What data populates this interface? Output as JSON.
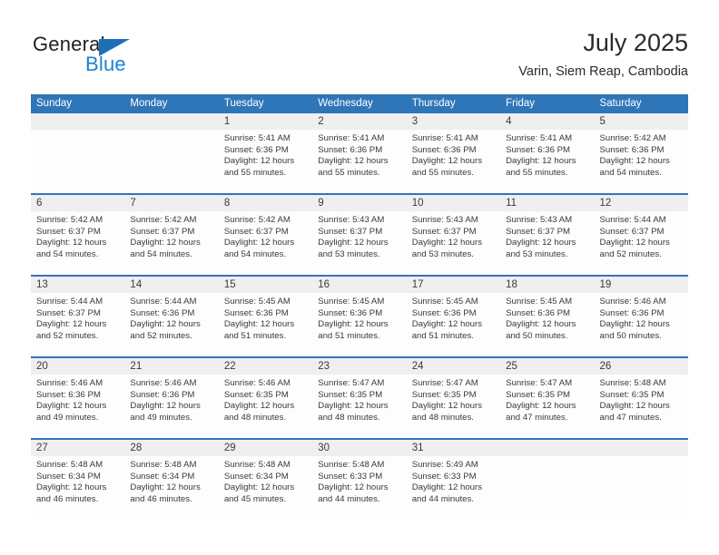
{
  "brand": {
    "name_part1": "General",
    "name_part2": "Blue",
    "triangle_icon": "triangle-icon",
    "color_dark": "#222222",
    "color_blue": "#1d82d2"
  },
  "header": {
    "title": "July 2025",
    "subtitle": "Varin, Siem Reap, Cambodia"
  },
  "theme": {
    "header_blue": "#2f76b8",
    "day_band_gray": "#efefef",
    "cell_white": "#fdfdfd"
  },
  "weekdays": [
    "Sunday",
    "Monday",
    "Tuesday",
    "Wednesday",
    "Thursday",
    "Friday",
    "Saturday"
  ],
  "weeks": [
    [
      {
        "day": "",
        "sunrise": "",
        "sunset": "",
        "daylight_line1": "",
        "daylight_line2": ""
      },
      {
        "day": "",
        "sunrise": "",
        "sunset": "",
        "daylight_line1": "",
        "daylight_line2": ""
      },
      {
        "day": "1",
        "sunrise": "Sunrise: 5:41 AM",
        "sunset": "Sunset: 6:36 PM",
        "daylight_line1": "Daylight: 12 hours",
        "daylight_line2": "and 55 minutes."
      },
      {
        "day": "2",
        "sunrise": "Sunrise: 5:41 AM",
        "sunset": "Sunset: 6:36 PM",
        "daylight_line1": "Daylight: 12 hours",
        "daylight_line2": "and 55 minutes."
      },
      {
        "day": "3",
        "sunrise": "Sunrise: 5:41 AM",
        "sunset": "Sunset: 6:36 PM",
        "daylight_line1": "Daylight: 12 hours",
        "daylight_line2": "and 55 minutes."
      },
      {
        "day": "4",
        "sunrise": "Sunrise: 5:41 AM",
        "sunset": "Sunset: 6:36 PM",
        "daylight_line1": "Daylight: 12 hours",
        "daylight_line2": "and 55 minutes."
      },
      {
        "day": "5",
        "sunrise": "Sunrise: 5:42 AM",
        "sunset": "Sunset: 6:36 PM",
        "daylight_line1": "Daylight: 12 hours",
        "daylight_line2": "and 54 minutes."
      }
    ],
    [
      {
        "day": "6",
        "sunrise": "Sunrise: 5:42 AM",
        "sunset": "Sunset: 6:37 PM",
        "daylight_line1": "Daylight: 12 hours",
        "daylight_line2": "and 54 minutes."
      },
      {
        "day": "7",
        "sunrise": "Sunrise: 5:42 AM",
        "sunset": "Sunset: 6:37 PM",
        "daylight_line1": "Daylight: 12 hours",
        "daylight_line2": "and 54 minutes."
      },
      {
        "day": "8",
        "sunrise": "Sunrise: 5:42 AM",
        "sunset": "Sunset: 6:37 PM",
        "daylight_line1": "Daylight: 12 hours",
        "daylight_line2": "and 54 minutes."
      },
      {
        "day": "9",
        "sunrise": "Sunrise: 5:43 AM",
        "sunset": "Sunset: 6:37 PM",
        "daylight_line1": "Daylight: 12 hours",
        "daylight_line2": "and 53 minutes."
      },
      {
        "day": "10",
        "sunrise": "Sunrise: 5:43 AM",
        "sunset": "Sunset: 6:37 PM",
        "daylight_line1": "Daylight: 12 hours",
        "daylight_line2": "and 53 minutes."
      },
      {
        "day": "11",
        "sunrise": "Sunrise: 5:43 AM",
        "sunset": "Sunset: 6:37 PM",
        "daylight_line1": "Daylight: 12 hours",
        "daylight_line2": "and 53 minutes."
      },
      {
        "day": "12",
        "sunrise": "Sunrise: 5:44 AM",
        "sunset": "Sunset: 6:37 PM",
        "daylight_line1": "Daylight: 12 hours",
        "daylight_line2": "and 52 minutes."
      }
    ],
    [
      {
        "day": "13",
        "sunrise": "Sunrise: 5:44 AM",
        "sunset": "Sunset: 6:37 PM",
        "daylight_line1": "Daylight: 12 hours",
        "daylight_line2": "and 52 minutes."
      },
      {
        "day": "14",
        "sunrise": "Sunrise: 5:44 AM",
        "sunset": "Sunset: 6:36 PM",
        "daylight_line1": "Daylight: 12 hours",
        "daylight_line2": "and 52 minutes."
      },
      {
        "day": "15",
        "sunrise": "Sunrise: 5:45 AM",
        "sunset": "Sunset: 6:36 PM",
        "daylight_line1": "Daylight: 12 hours",
        "daylight_line2": "and 51 minutes."
      },
      {
        "day": "16",
        "sunrise": "Sunrise: 5:45 AM",
        "sunset": "Sunset: 6:36 PM",
        "daylight_line1": "Daylight: 12 hours",
        "daylight_line2": "and 51 minutes."
      },
      {
        "day": "17",
        "sunrise": "Sunrise: 5:45 AM",
        "sunset": "Sunset: 6:36 PM",
        "daylight_line1": "Daylight: 12 hours",
        "daylight_line2": "and 51 minutes."
      },
      {
        "day": "18",
        "sunrise": "Sunrise: 5:45 AM",
        "sunset": "Sunset: 6:36 PM",
        "daylight_line1": "Daylight: 12 hours",
        "daylight_line2": "and 50 minutes."
      },
      {
        "day": "19",
        "sunrise": "Sunrise: 5:46 AM",
        "sunset": "Sunset: 6:36 PM",
        "daylight_line1": "Daylight: 12 hours",
        "daylight_line2": "and 50 minutes."
      }
    ],
    [
      {
        "day": "20",
        "sunrise": "Sunrise: 5:46 AM",
        "sunset": "Sunset: 6:36 PM",
        "daylight_line1": "Daylight: 12 hours",
        "daylight_line2": "and 49 minutes."
      },
      {
        "day": "21",
        "sunrise": "Sunrise: 5:46 AM",
        "sunset": "Sunset: 6:36 PM",
        "daylight_line1": "Daylight: 12 hours",
        "daylight_line2": "and 49 minutes."
      },
      {
        "day": "22",
        "sunrise": "Sunrise: 5:46 AM",
        "sunset": "Sunset: 6:35 PM",
        "daylight_line1": "Daylight: 12 hours",
        "daylight_line2": "and 48 minutes."
      },
      {
        "day": "23",
        "sunrise": "Sunrise: 5:47 AM",
        "sunset": "Sunset: 6:35 PM",
        "daylight_line1": "Daylight: 12 hours",
        "daylight_line2": "and 48 minutes."
      },
      {
        "day": "24",
        "sunrise": "Sunrise: 5:47 AM",
        "sunset": "Sunset: 6:35 PM",
        "daylight_line1": "Daylight: 12 hours",
        "daylight_line2": "and 48 minutes."
      },
      {
        "day": "25",
        "sunrise": "Sunrise: 5:47 AM",
        "sunset": "Sunset: 6:35 PM",
        "daylight_line1": "Daylight: 12 hours",
        "daylight_line2": "and 47 minutes."
      },
      {
        "day": "26",
        "sunrise": "Sunrise: 5:48 AM",
        "sunset": "Sunset: 6:35 PM",
        "daylight_line1": "Daylight: 12 hours",
        "daylight_line2": "and 47 minutes."
      }
    ],
    [
      {
        "day": "27",
        "sunrise": "Sunrise: 5:48 AM",
        "sunset": "Sunset: 6:34 PM",
        "daylight_line1": "Daylight: 12 hours",
        "daylight_line2": "and 46 minutes."
      },
      {
        "day": "28",
        "sunrise": "Sunrise: 5:48 AM",
        "sunset": "Sunset: 6:34 PM",
        "daylight_line1": "Daylight: 12 hours",
        "daylight_line2": "and 46 minutes."
      },
      {
        "day": "29",
        "sunrise": "Sunrise: 5:48 AM",
        "sunset": "Sunset: 6:34 PM",
        "daylight_line1": "Daylight: 12 hours",
        "daylight_line2": "and 45 minutes."
      },
      {
        "day": "30",
        "sunrise": "Sunrise: 5:48 AM",
        "sunset": "Sunset: 6:33 PM",
        "daylight_line1": "Daylight: 12 hours",
        "daylight_line2": "and 44 minutes."
      },
      {
        "day": "31",
        "sunrise": "Sunrise: 5:49 AM",
        "sunset": "Sunset: 6:33 PM",
        "daylight_line1": "Daylight: 12 hours",
        "daylight_line2": "and 44 minutes."
      },
      {
        "day": "",
        "sunrise": "",
        "sunset": "",
        "daylight_line1": "",
        "daylight_line2": ""
      },
      {
        "day": "",
        "sunrise": "",
        "sunset": "",
        "daylight_line1": "",
        "daylight_line2": ""
      }
    ]
  ]
}
